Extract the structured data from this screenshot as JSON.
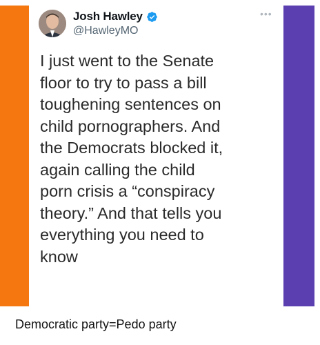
{
  "tweet": {
    "author": {
      "display_name": "Josh Hawley",
      "handle": "@HawleyMO",
      "verified": true
    },
    "text_lines": [
      "I just went to the Senate",
      "floor to try to pass a bill",
      "toughening sentences on",
      "child pornographers. And",
      "the Democrats blocked it,",
      "again calling the child",
      "porn crisis a “conspiracy",
      "theory.” And that tells you",
      "everything you need to",
      "know"
    ],
    "more_icon": "more-dots-icon"
  },
  "caption": "Democratic party=Pedo party",
  "colors": {
    "left_stripe": "#f57710",
    "right_stripe": "#5b3fb0",
    "verified_badge": "#1d9bf0",
    "handle_text": "#536471"
  }
}
